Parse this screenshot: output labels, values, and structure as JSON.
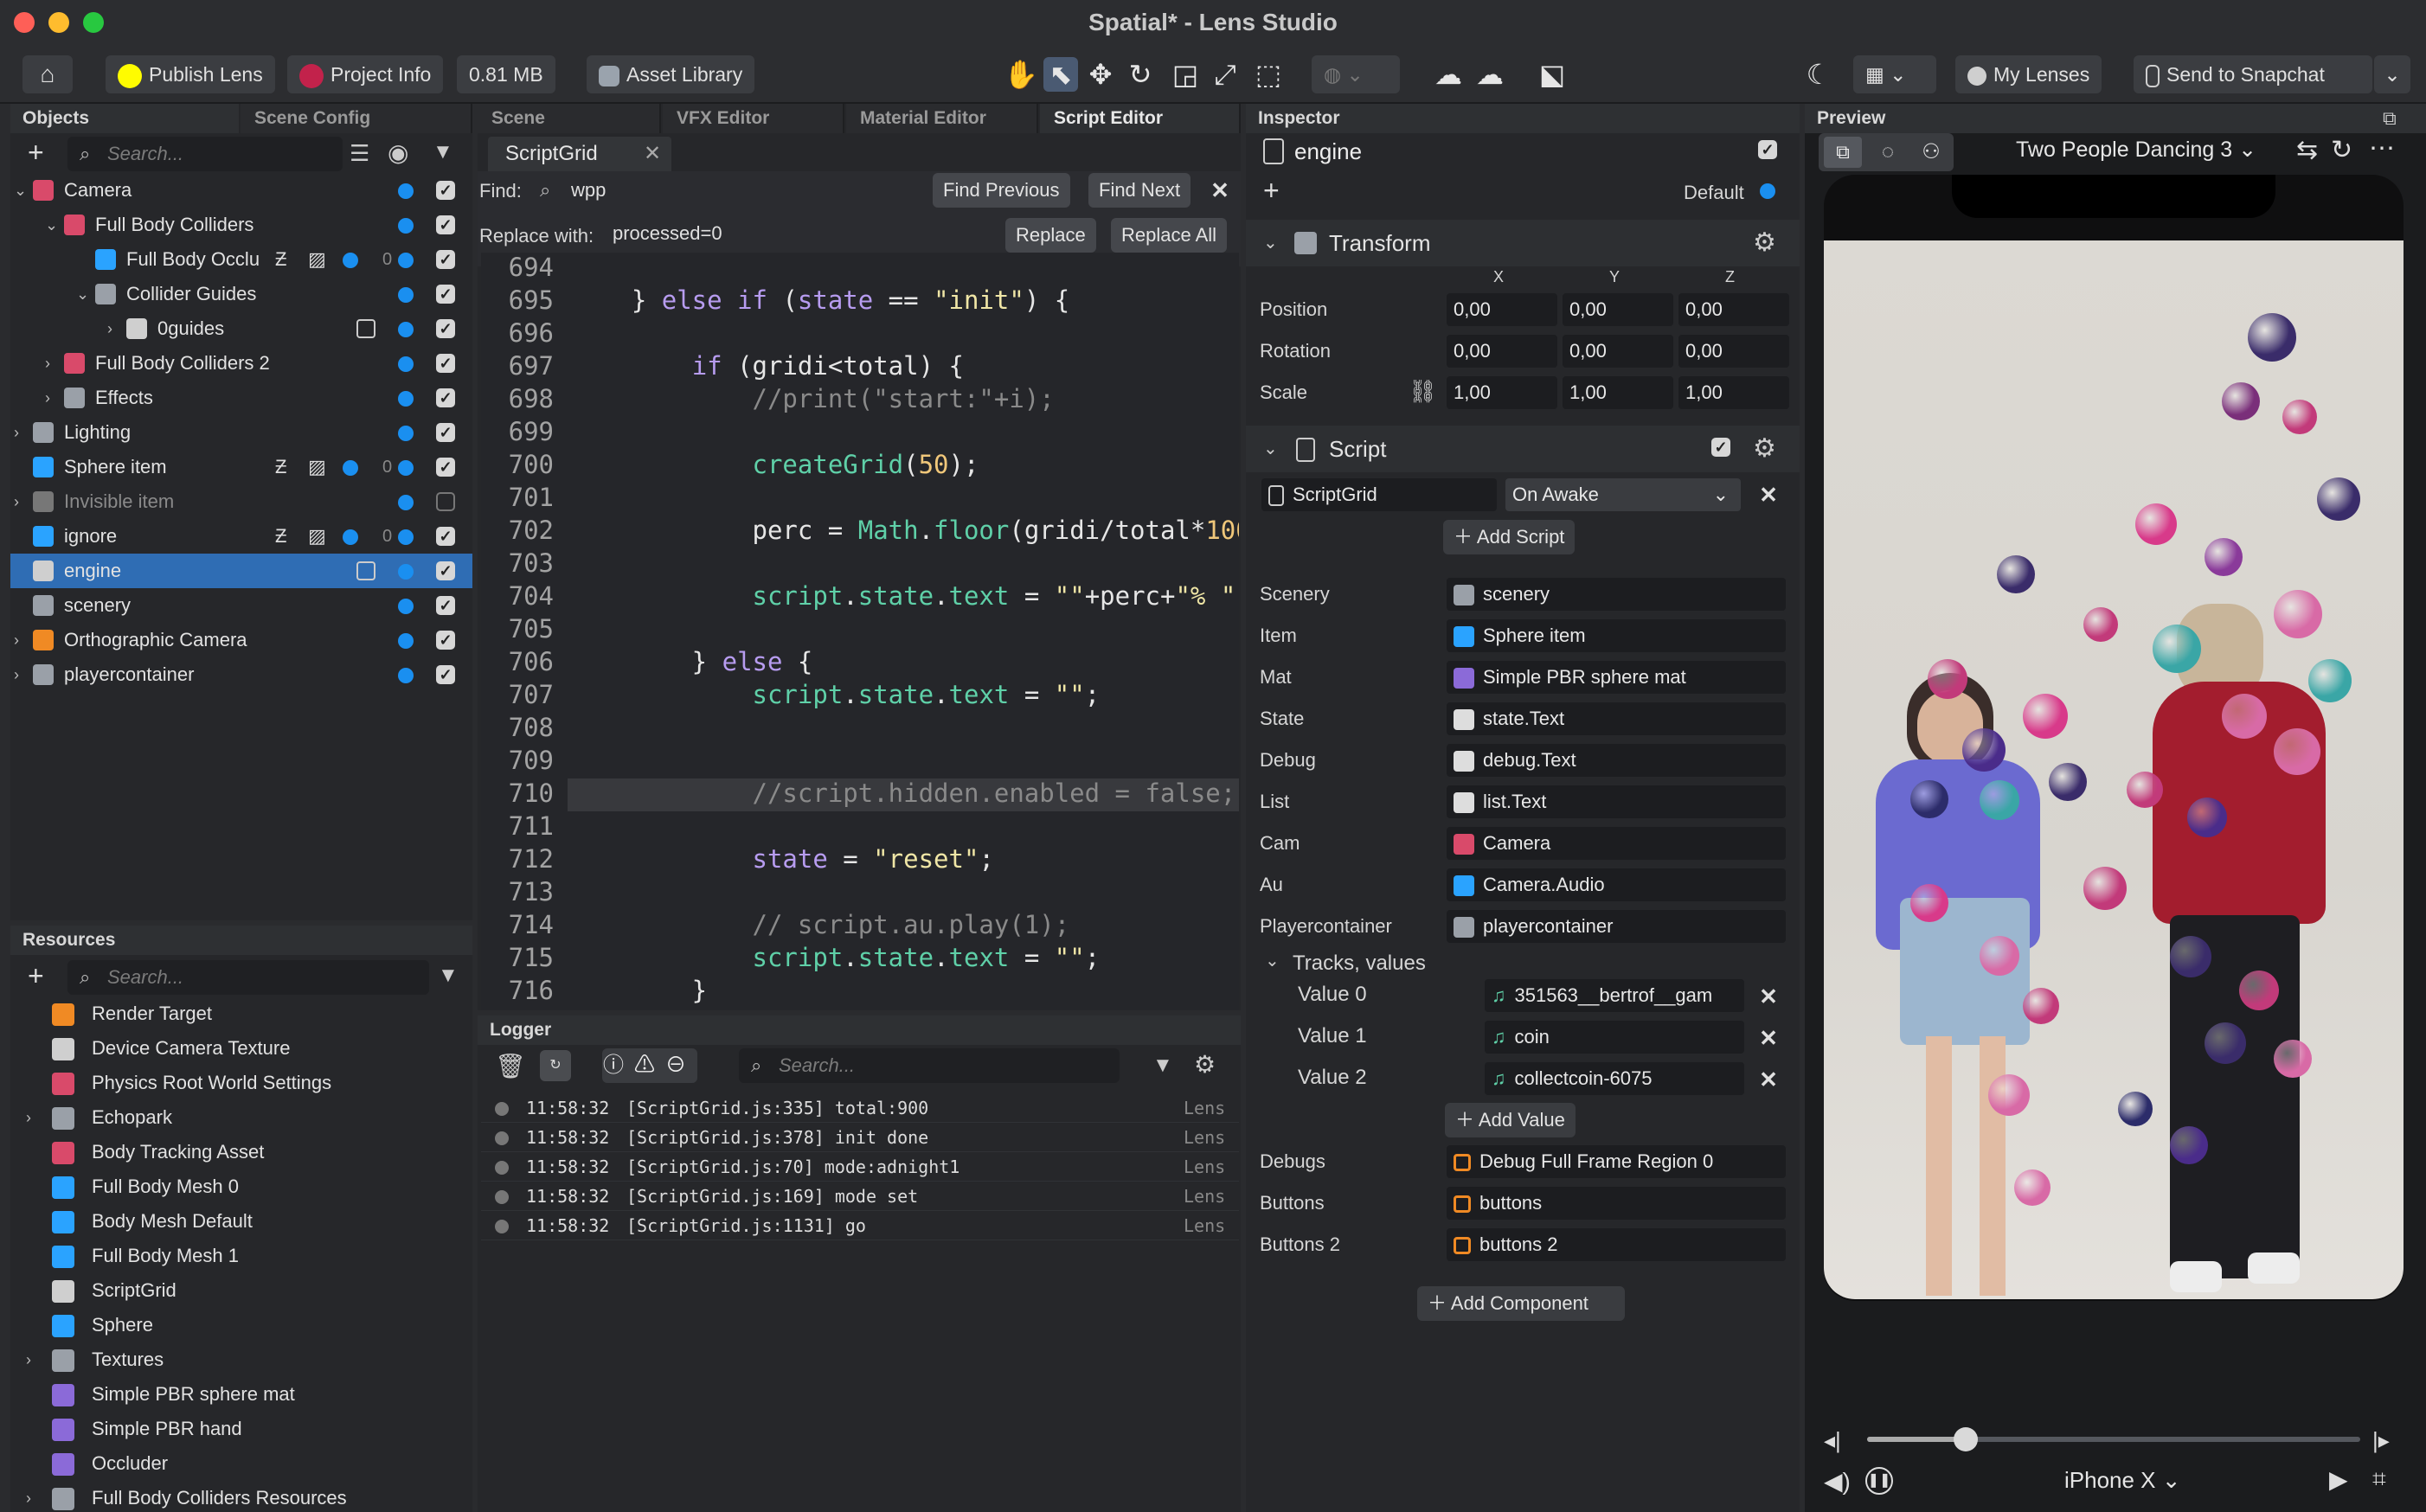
{
  "window": {
    "title": "Spatial* - Lens Studio"
  },
  "toolbar": {
    "publish": "Publish Lens",
    "project_info": "Project Info",
    "size": "0.81 MB",
    "asset_library": "Asset Library",
    "my_lenses": "My Lenses",
    "send": "Send to Snapchat"
  },
  "objects": {
    "tab_objects": "Objects",
    "tab_scene_config": "Scene Config",
    "search_placeholder": "Search...",
    "items": [
      {
        "label": "Camera",
        "zero": ""
      },
      {
        "label": "Full Body Colliders",
        "zero": ""
      },
      {
        "label": "Full Body Occlu",
        "zero": "0"
      },
      {
        "label": "Collider Guides",
        "zero": ""
      },
      {
        "label": "0guides",
        "zero": ""
      },
      {
        "label": "Full Body Colliders 2",
        "zero": ""
      },
      {
        "label": "Effects",
        "zero": ""
      },
      {
        "label": "Lighting",
        "zero": ""
      },
      {
        "label": "Sphere item",
        "zero": "0"
      },
      {
        "label": "Invisible item",
        "zero": ""
      },
      {
        "label": "ignore",
        "zero": "0"
      },
      {
        "label": "engine",
        "zero": ""
      },
      {
        "label": "scenery",
        "zero": ""
      },
      {
        "label": "Orthographic Camera",
        "zero": ""
      },
      {
        "label": "playercontainer",
        "zero": ""
      }
    ]
  },
  "resources": {
    "title": "Resources",
    "search_placeholder": "Search...",
    "items": [
      "Render Target",
      "Device Camera Texture",
      "Physics Root World Settings",
      "Echopark",
      "Body Tracking Asset",
      "Full Body Mesh 0",
      "Body Mesh Default",
      "Full Body Mesh 1",
      "ScriptGrid",
      "Sphere",
      "Textures",
      "Simple PBR sphere mat",
      "Simple PBR hand",
      "Occluder",
      "Full Body Colliders Resources"
    ]
  },
  "editor": {
    "tabs": [
      "Scene",
      "VFX Editor",
      "Material Editor",
      "Script Editor"
    ],
    "file_tab": "ScriptGrid",
    "find_label": "Find:",
    "find_value": "wpp",
    "find_previous": "Find Previous",
    "find_next": "Find Next",
    "replace_label": "Replace with:",
    "replace_value": "processed=0",
    "replace": "Replace",
    "replace_all": "Replace All",
    "line_numbers": [
      "694",
      "695",
      "696",
      "697",
      "698",
      "699",
      "700",
      "701",
      "702",
      "703",
      "704",
      "705",
      "706",
      "707",
      "708",
      "709",
      "710",
      "711",
      "712",
      "713",
      "714",
      "715",
      "716"
    ]
  },
  "logger": {
    "title": "Logger",
    "search_placeholder": "Search...",
    "entries": [
      {
        "time": "11:58:32",
        "text": "[ScriptGrid.js:335] total:900",
        "src": "Lens"
      },
      {
        "time": "11:58:32",
        "text": "[ScriptGrid.js:378] init done",
        "src": "Lens"
      },
      {
        "time": "11:58:32",
        "text": "[ScriptGrid.js:70] mode:adnight1",
        "src": "Lens"
      },
      {
        "time": "11:58:32",
        "text": "[ScriptGrid.js:169] mode set",
        "src": "Lens"
      },
      {
        "time": "11:58:32",
        "text": "[ScriptGrid.js:1131] go",
        "src": "Lens"
      }
    ]
  },
  "inspector": {
    "title": "Inspector",
    "object_name": "engine",
    "default_label": "Default",
    "transform": {
      "title": "Transform",
      "axes": [
        "X",
        "Y",
        "Z"
      ],
      "position_label": "Position",
      "position": [
        "0,00",
        "0,00",
        "0,00"
      ],
      "rotation_label": "Rotation",
      "rotation": [
        "0,00",
        "0,00",
        "0,00"
      ],
      "scale_label": "Scale",
      "scale": [
        "1,00",
        "1,00",
        "1,00"
      ]
    },
    "script": {
      "title": "Script",
      "asset": "ScriptGrid",
      "event": "On Awake",
      "add_script": "Add Script",
      "fields": [
        {
          "label": "Scenery",
          "value": "scenery"
        },
        {
          "label": "Item",
          "value": "Sphere item"
        },
        {
          "label": "Mat",
          "value": "Simple PBR sphere mat"
        },
        {
          "label": "State",
          "value": "state.Text"
        },
        {
          "label": "Debug",
          "value": "debug.Text"
        },
        {
          "label": "List",
          "value": "list.Text"
        },
        {
          "label": "Cam",
          "value": "Camera"
        },
        {
          "label": "Au",
          "value": "Camera.Audio"
        },
        {
          "label": "Playercontainer",
          "value": "playercontainer"
        }
      ],
      "tracks_label": "Tracks, values",
      "tracks": [
        {
          "label": "Value 0",
          "value": "351563__bertrof__gam"
        },
        {
          "label": "Value 1",
          "value": "coin"
        },
        {
          "label": "Value 2",
          "value": "collectcoin-6075"
        }
      ],
      "add_value": "Add Value",
      "fields2": [
        {
          "label": "Debugs",
          "value": "Debug Full Frame Region 0"
        },
        {
          "label": "Buttons",
          "value": "buttons"
        },
        {
          "label": "Buttons 2",
          "value": "buttons 2"
        }
      ]
    },
    "add_component": "Add Component"
  },
  "preview": {
    "title": "Preview",
    "video": "Two People Dancing 3",
    "device": "iPhone X",
    "playback_progress": 0.2
  }
}
